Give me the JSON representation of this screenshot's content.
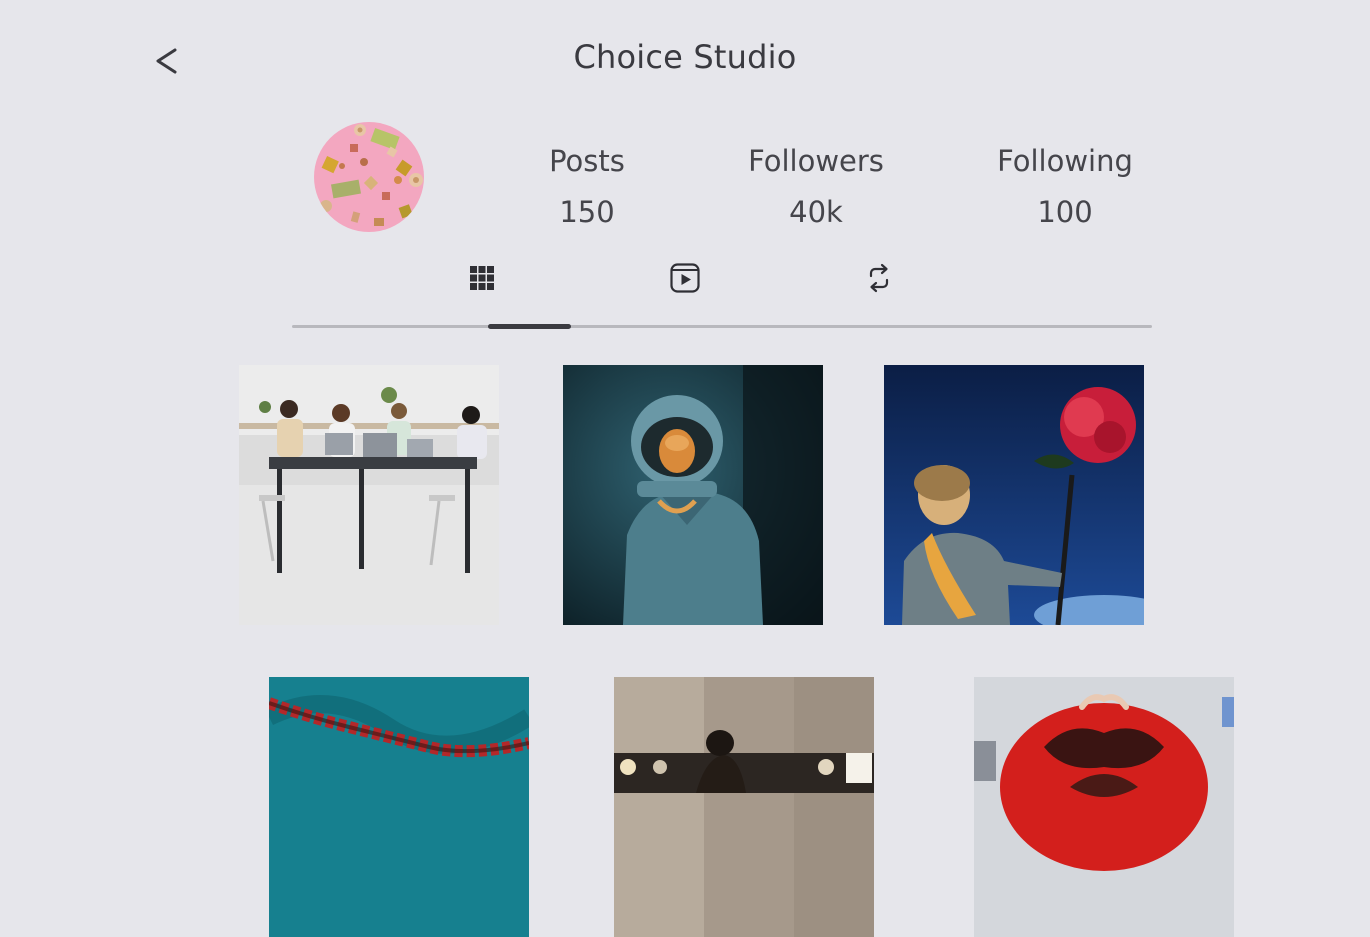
{
  "header": {
    "back_glyph": "<",
    "title": "Choice Studio"
  },
  "profile": {
    "avatar_icon": "abstract-shapes-avatar",
    "stats": [
      {
        "label": "Posts",
        "value": "150"
      },
      {
        "label": "Followers",
        "value": "40k"
      },
      {
        "label": "Following",
        "value": "100"
      }
    ]
  },
  "tabs": [
    {
      "icon": "grid-icon",
      "active": true
    },
    {
      "icon": "video-play-icon",
      "active": false
    },
    {
      "icon": "repost-icon",
      "active": false
    }
  ],
  "posts": [
    {
      "subject": "team-meeting-photo"
    },
    {
      "subject": "astronaut-portrait-photo"
    },
    {
      "subject": "boy-with-rose-photo"
    },
    {
      "subject": "pool-rope-photo"
    },
    {
      "subject": "studio-musician-photo"
    },
    {
      "subject": "red-dress-photo"
    }
  ],
  "colors": {
    "background": "#e6e6eb",
    "text": "#3a3a40",
    "avatar_pink": "#f3a7c0",
    "tab_track": "#b8b8bd"
  }
}
